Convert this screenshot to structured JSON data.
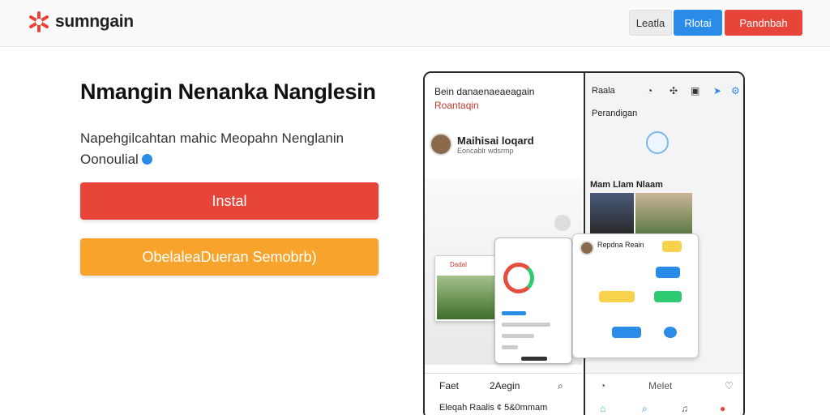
{
  "brand": {
    "name": "sumngain",
    "accent": "#e8453a",
    "blue": "#2a8be8",
    "orange": "#f8a42c"
  },
  "header": {
    "login_label": "Leatla",
    "free_label": "Rlotai",
    "signup_label": "Pandnbah"
  },
  "hero": {
    "title": "Nmangin Nenanka Nanglesin",
    "subtitle_line1": "Napehgilcahtan mahic Meopahn Nenglanin",
    "subtitle_line2": "Oonoulial",
    "install_label": "Instal",
    "secondary_label": "ObelaleaDueran Semobrb)"
  },
  "phone": {
    "left": {
      "heading": "Bein danaenaeaeagain",
      "heading2": "Roantaqin",
      "profile_name": "Maihisai loqard",
      "profile_sub": "Eoncablr wdsrmp",
      "mini_card_title": "Dadal",
      "bottom_left": "Faet",
      "bottom_mid": "2Aegin",
      "bottom_line2": "Eleqah Raalis ¢ 5&0mmam"
    },
    "right": {
      "title": "Raala",
      "section": "Perandigan",
      "subsection": "Mam Llam Nlaam",
      "card_name": "Repdna Reain",
      "icons": [
        "clock-icon",
        "share-icon",
        "image-icon",
        "pin-icon",
        "settings-icon"
      ],
      "bottom_icon_label": "Melet"
    }
  }
}
